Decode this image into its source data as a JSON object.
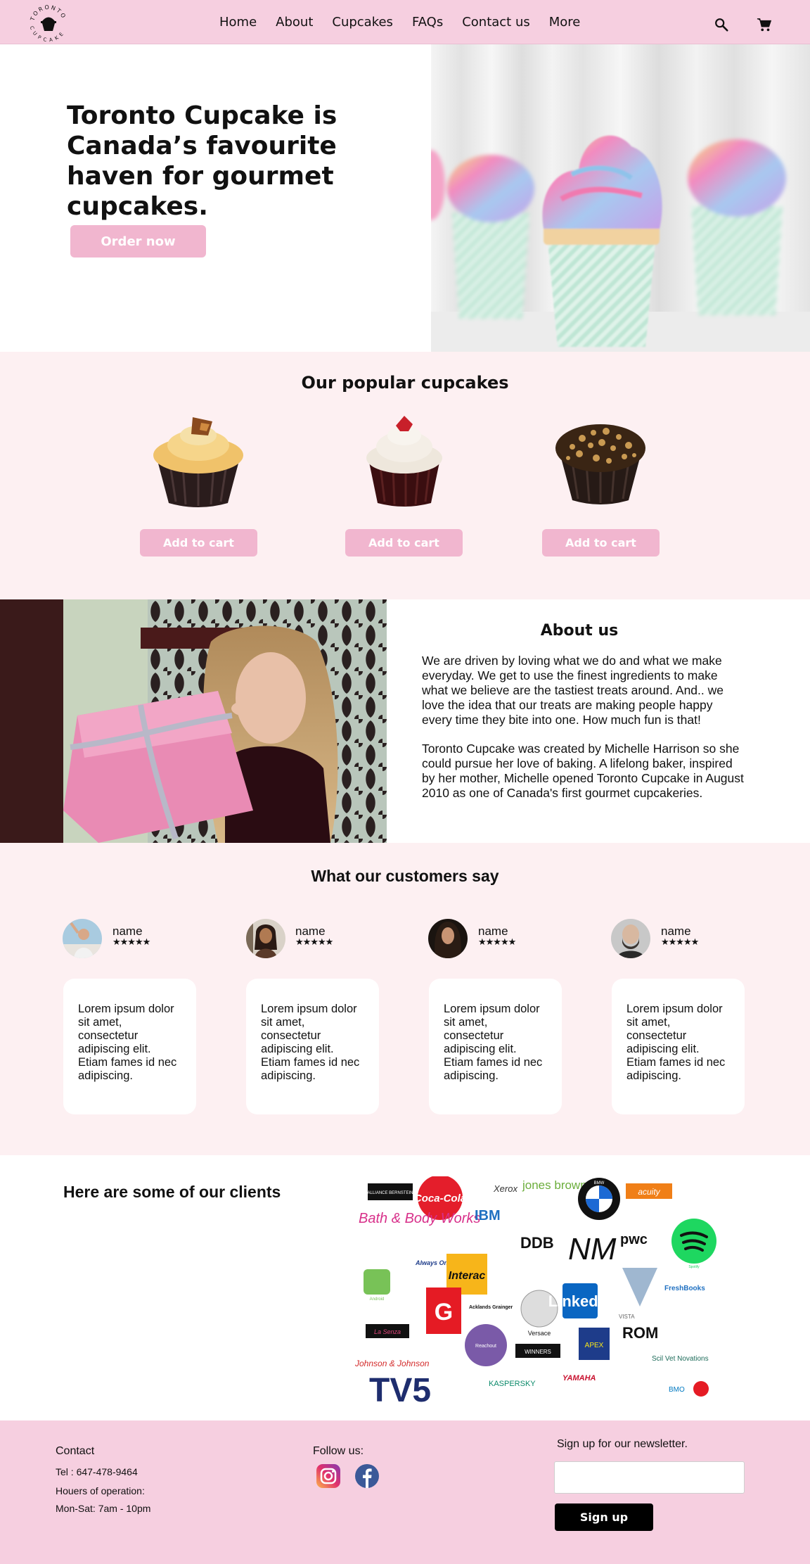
{
  "nav": {
    "logo_text_top": "TORONTO",
    "logo_text_bottom": "CUPCAKE",
    "items": [
      {
        "label": "Home"
      },
      {
        "label": "About"
      },
      {
        "label": "Cupcakes"
      },
      {
        "label": "FAQs"
      },
      {
        "label": "Contact us"
      },
      {
        "label": "More"
      }
    ],
    "search_icon": "search-icon",
    "cart_icon": "cart-icon"
  },
  "hero": {
    "title": "Toronto Cupcake is Canada’s favourite haven for gourmet cupcakes.",
    "order_label": "Order now"
  },
  "popular": {
    "title": "Our popular cupcakes",
    "items": [
      {
        "add_label": "Add to cart"
      },
      {
        "add_label": "Add to cart"
      },
      {
        "add_label": "Add to cart"
      }
    ]
  },
  "about": {
    "title": "About us",
    "p1": "We are driven by loving what we do and what we make everyday. We get to use the finest ingredients to make what we believe are the tastiest treats around. And.. we love the idea that our treats are making people happy every time they bite into one. How much fun is that!",
    "p2": "Toronto Cupcake was created by Michelle Harrison so she could pursue her love of baking. A lifelong baker, inspired by her mother, Michelle opened Toronto Cupcake in August 2010 as one of Canada's first gourmet cupcakeries."
  },
  "testimonials": {
    "title": "What our customers say",
    "items": [
      {
        "name": "name",
        "stars": "★★★★★",
        "text": "Lorem ipsum dolor sit amet, consectetur adipiscing elit. Etiam fames id nec adipiscing."
      },
      {
        "name": "name",
        "stars": "★★★★★",
        "text": "Lorem ipsum dolor sit amet, consectetur adipiscing elit. Etiam fames id nec adipiscing."
      },
      {
        "name": "name",
        "stars": "★★★★★",
        "text": "Lorem ipsum dolor sit amet, consectetur adipiscing elit. Etiam fames id nec adipiscing."
      },
      {
        "name": "name",
        "stars": "★★★★★",
        "text": "Lorem ipsum dolor sit amet, consectetur adipiscing elit. Etiam fames id nec adipiscing."
      }
    ]
  },
  "clients": {
    "title": "Here are some of our clients",
    "logos": [
      "ALLIANCE BERNSTEIN",
      "Coca-Cola",
      "Xerox",
      "jones brown",
      "BMW",
      "acuity",
      "Bath & Body Works",
      "IBM",
      "DDB",
      "pwc",
      "Spotify",
      "Android",
      "Always On Call",
      "Interac",
      "NM",
      "FreshBooks",
      "G",
      "Acklands Grainger",
      "Versace",
      "LinkedIn",
      "VISTA",
      "La Senza",
      "Reachout",
      "WINNERS",
      "APEX",
      "ROM",
      "Johnson & Johnson",
      "Scil Vet Novations",
      "TV5",
      "KASPERSKY",
      "YAMAHA",
      "BMO"
    ]
  },
  "footer": {
    "contact_title": "Contact",
    "tel": "Tel : 647-478-9464",
    "hours_label": "Houers of operation:",
    "hours": "Mon-Sat: 7am - 10pm",
    "follow": "Follow us:",
    "instagram_icon": "instagram-icon",
    "facebook_icon": "facebook-icon",
    "newsletter": "Sign up for our newsletter.",
    "signup_label": "Sign up"
  },
  "colors": {
    "nav_bg": "#f6cfe0",
    "section_pink": "#fdf0f2",
    "button_pink": "#f1b6cf",
    "signup_btn": "#000000"
  }
}
